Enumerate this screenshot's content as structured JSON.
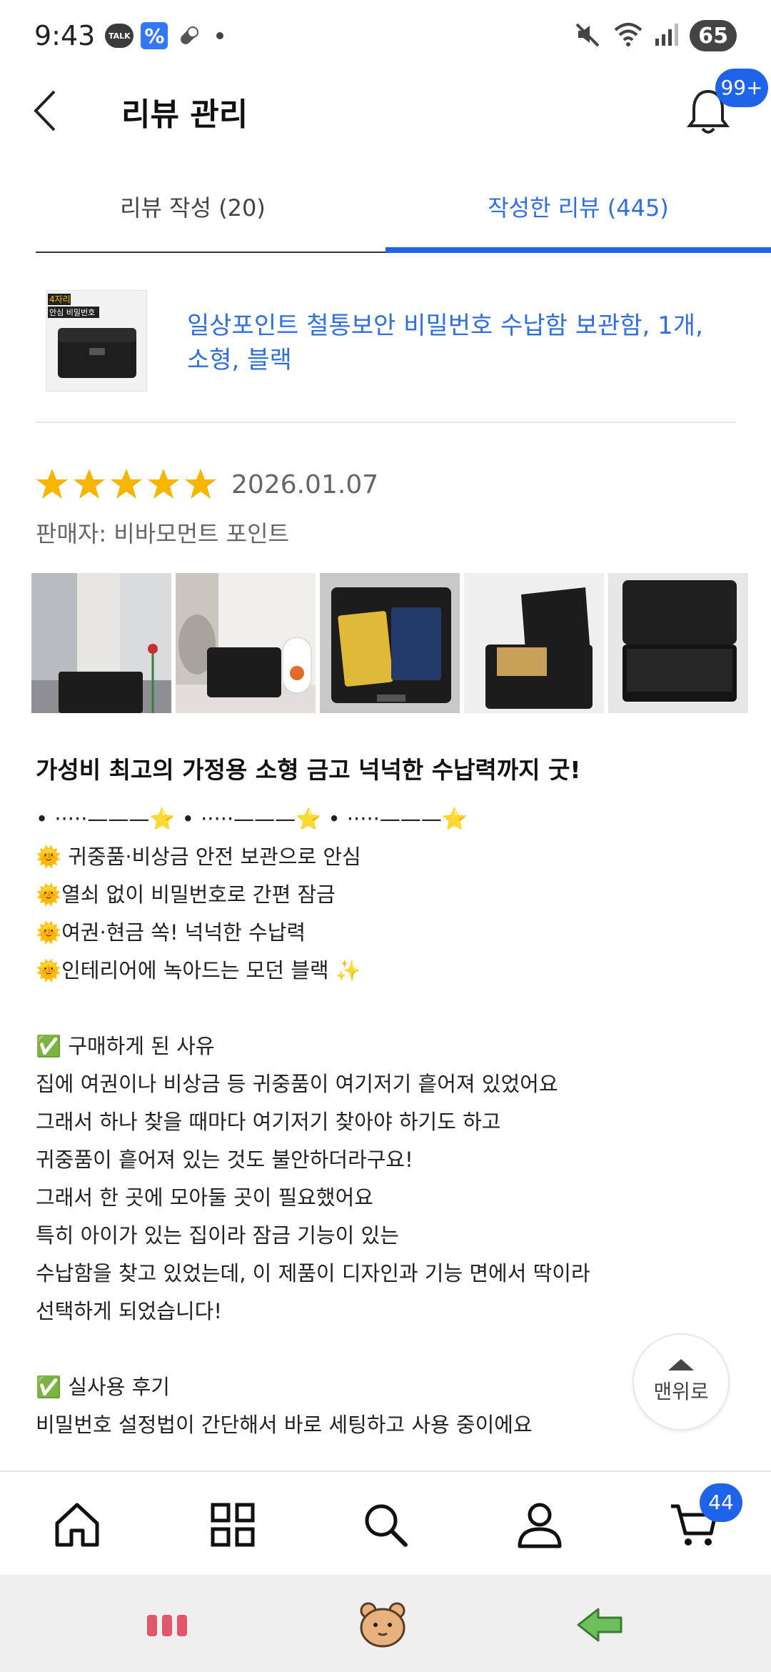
{
  "status_bar": {
    "time": "9:43",
    "notification_icons": [
      "kakaotalk-icon",
      "percent-app-icon",
      "pill-icon"
    ],
    "talk_label": "TALK",
    "percent_label": "%",
    "battery": "65"
  },
  "header": {
    "title": "리뷰 관리",
    "notification_badge": "99+"
  },
  "tabs": [
    {
      "label": "리뷰 작성 (20)",
      "active": false
    },
    {
      "label": "작성한 리뷰 (445)",
      "active": true
    }
  ],
  "product": {
    "name": "일상포인트 철통보안 비밀번호 수납함 보관함, 1개, 소형, 블랙",
    "thumb_tag": "4자리",
    "thumb_caption": "안심 비밀번호"
  },
  "review": {
    "rating": 5,
    "date": "2026.01.07",
    "seller": "판매자: 비바모먼트 포인트",
    "photo_count": 5,
    "title": "가성비 최고의 가정용 소형 금고 넉넉한 수납력까지 굿!",
    "lines": [
      "• ·····———⭐ • ·····———⭐ • ·····———⭐",
      "🌞 귀중품·비상금 안전 보관으로 안심",
      "🌞열쇠 없이 비밀번호로 간편 잠금",
      "🌞여권·현금 쏙! 넉넉한 수납력",
      "🌞인테리어에 녹아드는 모던 블랙 ✨",
      "",
      "✅ 구매하게 된 사유",
      "집에 여권이나 비상금 등 귀중품이 여기저기 흩어져 있었어요",
      "그래서 하나 찾을 때마다 여기저기 찾아야 하기도 하고",
      "귀중품이 흩어져 있는 것도 불안하더라구요!",
      "그래서 한 곳에 모아둘 곳이 필요했어요",
      "특히 아이가 있는 집이라 잠금 기능이 있는",
      "수납함을 찾고 있었는데, 이 제품이 디자인과 기능 면에서 딱이라",
      "선택하게 되었습니다!",
      "",
      "✅ 실사용 후기",
      "비밀번호 설정법이 간단해서 바로 세팅하고 사용 중이에요"
    ]
  },
  "to_top": {
    "label": "맨위로"
  },
  "bottom_nav": {
    "items": [
      "home-icon",
      "category-grid-icon",
      "search-icon",
      "my-page-icon",
      "cart-icon"
    ],
    "cart_badge": "44"
  },
  "colors": {
    "accent": "#1e63e9",
    "link": "#2f6fe0",
    "star": "#f7b500"
  }
}
